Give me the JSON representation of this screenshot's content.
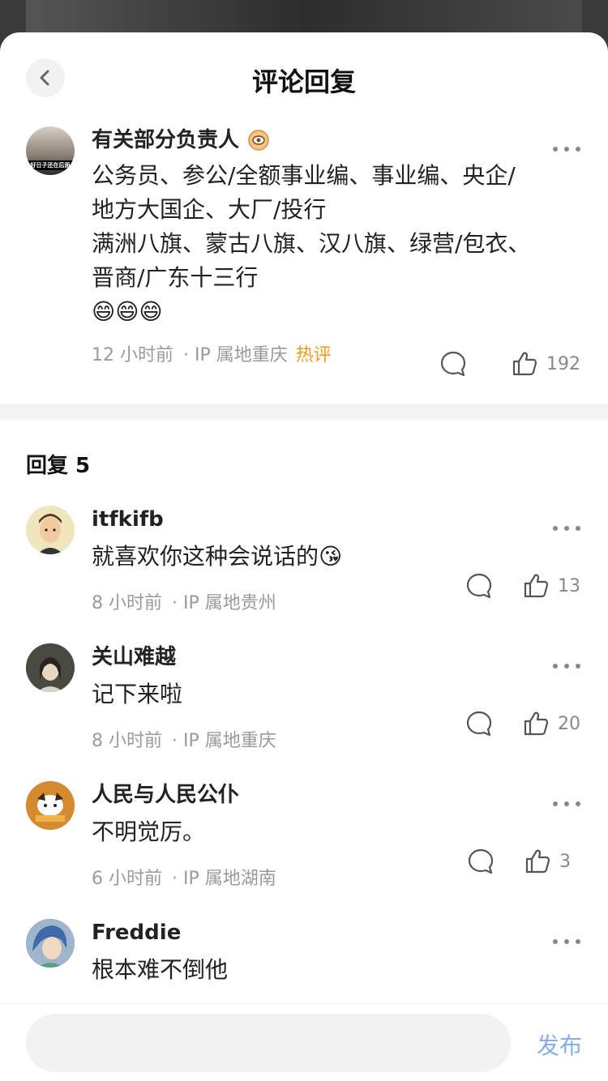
{
  "header": {
    "title": "评论回复"
  },
  "main_comment": {
    "author": "有关部分负责人",
    "avatar_caption": "好日子还在后面",
    "lines": [
      "公务员、参公/全额事业编、事业编、央企/",
      "地方大国企、大厂/投行",
      "满洲八旗、蒙古八旗、汉八旗、绿营/包衣、",
      "晋商/广东十三行",
      "😄😄😄"
    ],
    "time": "12 小时前",
    "ip": "· IP 属地重庆",
    "tag": "热评",
    "likes": "192"
  },
  "replies_header": "回复 5",
  "replies": [
    {
      "author": "itfkifb",
      "text": "就喜欢你这种会说话的😘",
      "time": "8 小时前",
      "ip": "· IP 属地贵州",
      "likes": "13"
    },
    {
      "author": "关山难越",
      "text": "记下来啦",
      "time": "8 小时前",
      "ip": "· IP 属地重庆",
      "likes": "20"
    },
    {
      "author": "人民与人民公仆",
      "text": "不明觉厉。",
      "time": "6 小时前",
      "ip": "· IP 属地湖南",
      "likes": "3"
    },
    {
      "author": "Freddie",
      "text": "根本难不倒他"
    }
  ],
  "footer": {
    "input_placeholder": "",
    "publish_label": "发布"
  },
  "colors": {
    "hot": "#f39a1c",
    "publish": "#84b0e8"
  },
  "icons": [
    "back-chevron-icon",
    "more-dots-icon",
    "comment-bubble-icon",
    "thumbs-up-icon",
    "badge-icon"
  ]
}
